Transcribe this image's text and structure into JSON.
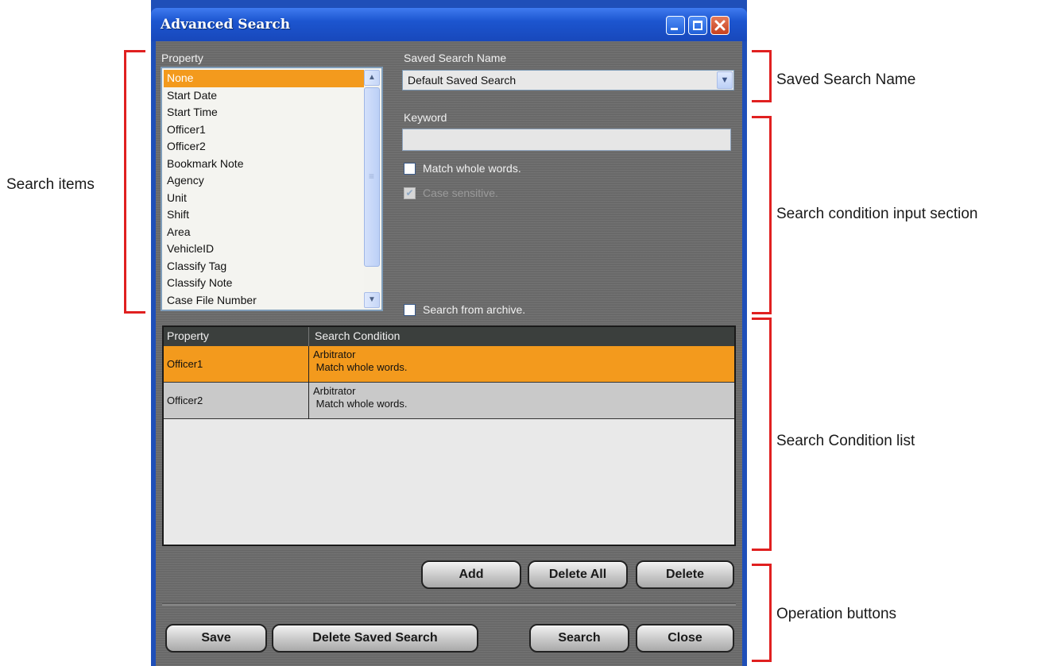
{
  "window": {
    "title": "Advanced Search"
  },
  "property": {
    "label": "Property",
    "items": [
      "None",
      "Start Date",
      "Start Time",
      "Officer1",
      "Officer2",
      "Bookmark Note",
      "Agency",
      "Unit",
      "Shift",
      "Area",
      "VehicleID",
      "Classify Tag",
      "Classify Note",
      "Case File Number"
    ],
    "selected": "None"
  },
  "saved_search": {
    "label": "Saved Search Name",
    "value": "Default Saved Search"
  },
  "keyword": {
    "label": "Keyword",
    "value": ""
  },
  "options": {
    "match_whole_words": "Match whole words.",
    "case_sensitive": "Case sensitive.",
    "search_from_archive": "Search from archive."
  },
  "condition_table": {
    "headers": [
      "Property",
      "Search Condition"
    ],
    "rows": [
      {
        "property": "Officer1",
        "condition_line1": "Arbitrator",
        "condition_line2": " Match whole words."
      },
      {
        "property": "Officer2",
        "condition_line1": "Arbitrator",
        "condition_line2": " Match whole words."
      }
    ]
  },
  "buttons": {
    "add": "Add",
    "delete_all": "Delete All",
    "delete": "Delete",
    "save": "Save",
    "delete_saved_search": "Delete Saved Search",
    "search": "Search",
    "close": "Close"
  },
  "annotations": {
    "search_items": "Search items",
    "saved_search_name": "Saved Search Name",
    "search_condition_input": "Search condition input section",
    "search_condition_list": "Search Condition list",
    "operation_buttons": "Operation buttons"
  },
  "colors": {
    "selection": "#f39a1d",
    "annotation_bracket": "#e02020",
    "title_bar": "#1c55cf"
  }
}
